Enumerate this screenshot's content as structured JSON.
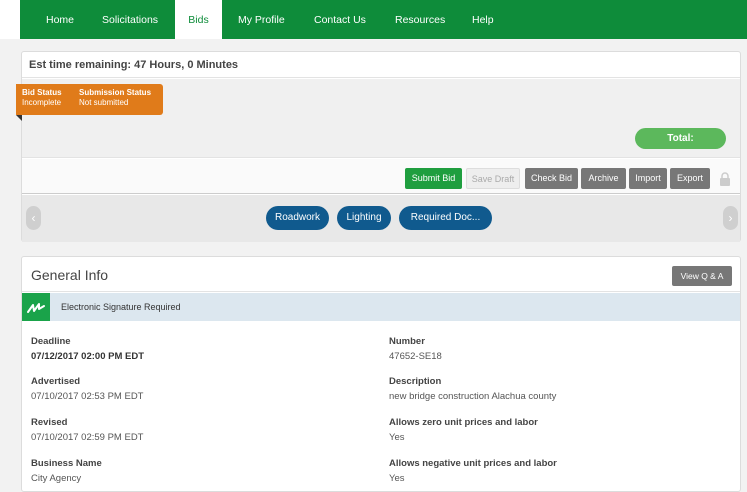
{
  "nav": {
    "items": [
      "Home",
      "Solicitations",
      "Bids",
      "My Profile",
      "Contact Us",
      "Resources",
      "Help"
    ]
  },
  "time_remaining": "Est time remaining: 47 Hours, 0 Minutes",
  "status": {
    "bid_status_label": "Bid Status",
    "bid_status_value": "Incomplete",
    "submission_label": "Submission Status",
    "submission_value": "Not submitted"
  },
  "total_label": "Total:",
  "toolbar": {
    "submit": "Submit Bid",
    "save": "Save Draft",
    "check": "Check Bid",
    "archive": "Archive",
    "import": "Import",
    "export": "Export"
  },
  "tabs": [
    "Roadwork",
    "Lighting",
    "Required Doc..."
  ],
  "general": {
    "title": "General Info",
    "qa_button": "View Q & A",
    "signature": "Electronic Signature Required",
    "fields_left": [
      {
        "label": "Deadline",
        "value": "07/12/2017 02:00 PM EDT"
      },
      {
        "label": "Advertised",
        "value": "07/10/2017 02:53 PM EDT"
      },
      {
        "label": "Revised",
        "value": "07/10/2017 02:59 PM EDT"
      },
      {
        "label": "Business Name",
        "value": "City Agency"
      }
    ],
    "fields_right": [
      {
        "label": "Number",
        "value": "47652-SE18"
      },
      {
        "label": "Description",
        "value": "new bridge construction Alachua county"
      },
      {
        "label": "Allows zero unit prices and labor",
        "value": "Yes"
      },
      {
        "label": "Allows negative unit prices and labor",
        "value": "Yes"
      }
    ]
  },
  "colors": {
    "nav_green": "#0e8c3a",
    "status_orange": "#e07b1a",
    "total_green": "#5cb85c",
    "tab_blue": "#105a8e"
  }
}
